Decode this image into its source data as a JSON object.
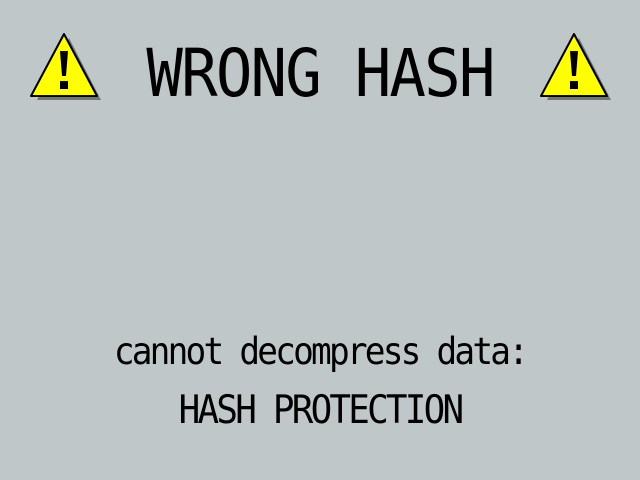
{
  "error_screen": {
    "title": "WRONG HASH",
    "message_line1": "cannot decompress data:",
    "message_line2": "HASH PROTECTION"
  },
  "icons": {
    "left": "warning-triangle-icon",
    "right": "warning-triangle-icon"
  },
  "colors": {
    "background": "#c0c7c8",
    "warning_fill": "#ffff00",
    "text": "#000000"
  }
}
